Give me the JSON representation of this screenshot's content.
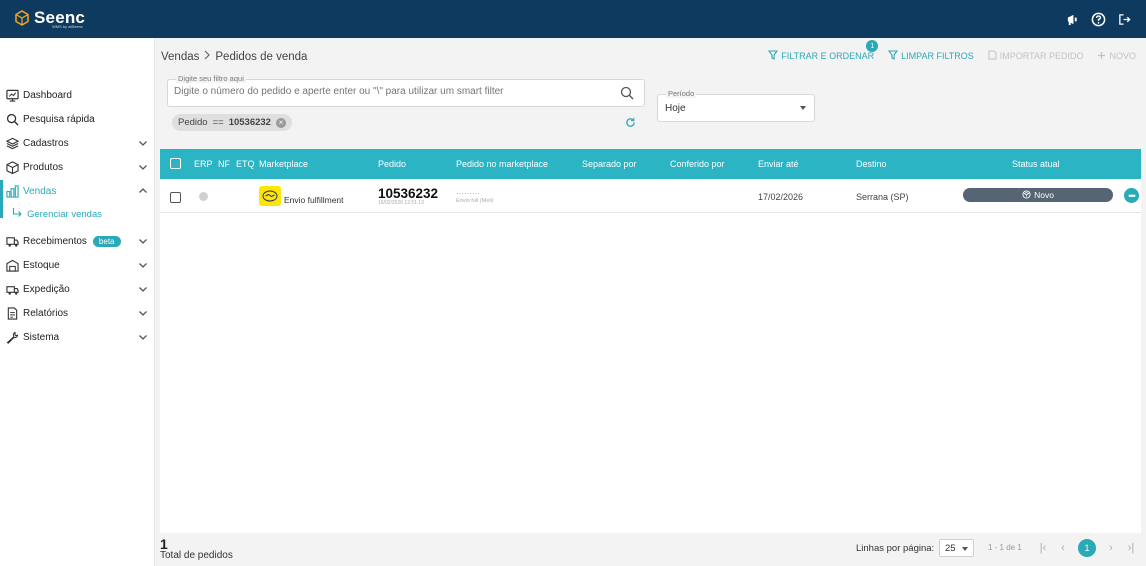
{
  "app": {
    "name": "Seenc",
    "tagline": "WMS by atSeenc"
  },
  "topbar": {
    "icons": [
      "megaphone-icon",
      "help-icon",
      "logout-icon"
    ]
  },
  "sidebar": {
    "items": [
      {
        "label": "Dashboard",
        "icon": "dashboard-icon"
      },
      {
        "label": "Pesquisa rápida",
        "icon": "search-icon"
      },
      {
        "label": "Cadastros",
        "icon": "layers-icon"
      },
      {
        "label": "Produtos",
        "icon": "box-icon"
      },
      {
        "label": "Vendas",
        "icon": "sales-icon"
      },
      {
        "label": "Recebimentos",
        "icon": "truck-icon",
        "badge": "beta"
      },
      {
        "label": "Estoque",
        "icon": "warehouse-icon"
      },
      {
        "label": "Expedição",
        "icon": "shipping-icon"
      },
      {
        "label": "Relatórios",
        "icon": "report-icon"
      },
      {
        "label": "Sistema",
        "icon": "wrench-icon"
      }
    ],
    "sub_item": "Gerenciar vendas"
  },
  "breadcrumb": {
    "root": "Vendas",
    "current": "Pedidos de venda"
  },
  "actions": {
    "filter": "FILTRAR E ORDENAR",
    "filter_count": "1",
    "clear": "LIMPAR FILTROS",
    "import": "IMPORTAR PEDIDO",
    "new": "NOVO"
  },
  "search": {
    "label": "Digite seu filtro aqui",
    "placeholder": "Digite o número do pedido e aperte enter ou \"\\\" para utilizar um smart filter"
  },
  "active_filter": {
    "field": "Pedido",
    "operator": "==",
    "value": "10536232"
  },
  "period": {
    "label": "Período",
    "value": "Hoje"
  },
  "table": {
    "columns": [
      "ERP",
      "NF",
      "ETQ",
      "Marketplace",
      "Pedido",
      "Pedido no marketplace",
      "Separado por",
      "Conferido por",
      "Enviar até",
      "Destino",
      "Status atual"
    ],
    "rows": [
      {
        "marketplace": "Envio fulfillment",
        "order": "10536232",
        "order_timestamp": "16/02/2026 12:51:13",
        "marketplace_order": "·········",
        "marketplace_sub": "Envio full (Meli)",
        "separated_by": "",
        "checked_by": "",
        "ship_by": "17/02/2026",
        "destination": "Serrana (SP)",
        "status": "Novo"
      }
    ]
  },
  "footer": {
    "total": "1",
    "total_label": "Total de pedidos",
    "rows_per_page_label": "Linhas por página:",
    "rows_per_page": "25",
    "range": "1 - 1 de 1",
    "current_page": "1"
  },
  "colors": {
    "topbar": "#0f3a5f",
    "accent": "#2aa9b8",
    "table_header": "#2bb5c4",
    "status_badge": "#556574",
    "marketplace_logo": "#ffe600"
  }
}
